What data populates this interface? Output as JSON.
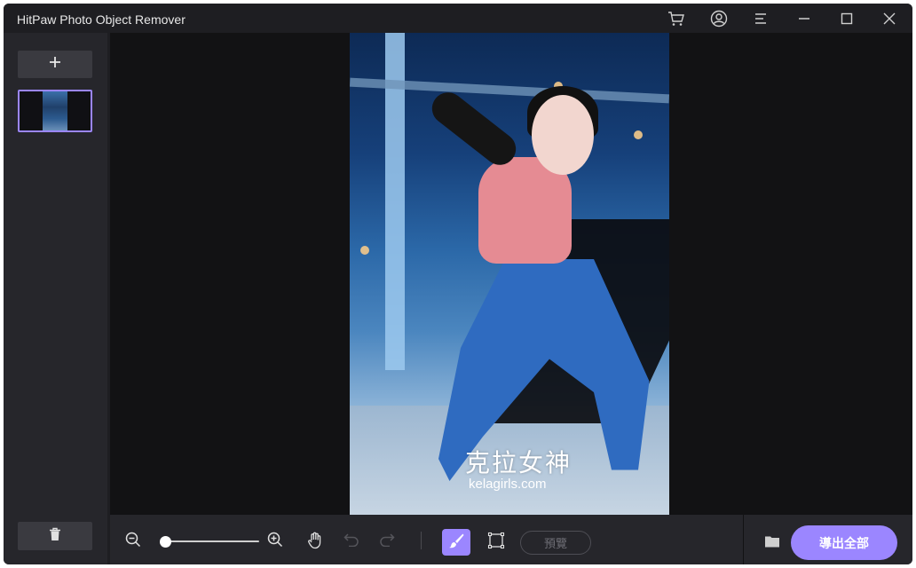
{
  "app": {
    "title": "HitPaw Photo Object Remover"
  },
  "titlebar": {
    "icons": [
      "cart-icon",
      "account-icon",
      "menu-icon",
      "minimize-icon",
      "maximize-icon",
      "close-icon"
    ]
  },
  "sidebar": {
    "add_label": "+",
    "icons": [
      "plus-icon",
      "trash-icon"
    ]
  },
  "canvas": {
    "watermark_cn": "克拉女神",
    "watermark_en": "kelagirls.com"
  },
  "toolbar": {
    "zoom_level": 0,
    "preview_label": "預覽",
    "export_label": "導出全部",
    "icons": [
      "zoom-out-icon",
      "zoom-in-icon",
      "hand-icon",
      "undo-icon",
      "redo-icon",
      "brush-icon",
      "rectangle-select-icon",
      "folder-icon"
    ]
  },
  "colors": {
    "accent": "#9b86ff",
    "window_bg": "#1e1e22",
    "panel_bg": "#26262b",
    "canvas_bg": "#121214"
  }
}
